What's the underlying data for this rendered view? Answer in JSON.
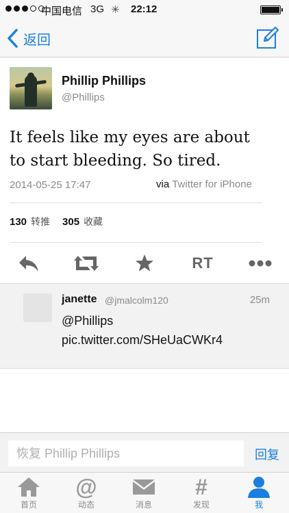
{
  "status_bar": {
    "carrier": "中国电信",
    "network": "3G",
    "time": "22:12"
  },
  "nav": {
    "back_label": "返回"
  },
  "tweet": {
    "user_name": "Phillip Phillips",
    "user_handle": "@Phillips",
    "text": "It feels like my eyes are about to start bleeding. So tired.",
    "timestamp": "2014-05-25 17:47",
    "via_word": "via",
    "via_source": "Twitter for iPhone",
    "retweets_count": "130",
    "retweets_label": "转推",
    "favorites_count": "305",
    "favorites_label": "收藏"
  },
  "actions": {
    "rt_label": "RT"
  },
  "reply": {
    "name": "janette",
    "handle": "@jmalcolm120",
    "time": "25m",
    "text": "@Phillips pic.twitter.com/SHeUaCWKr4"
  },
  "compose": {
    "placeholder": "恢复 Phillip Phillips",
    "send_label": "回复"
  },
  "tabbar": {
    "tabs": [
      {
        "label": "首页",
        "icon": "home-icon"
      },
      {
        "label": "动态",
        "icon": "at-icon"
      },
      {
        "label": "消息",
        "icon": "envelope-icon"
      },
      {
        "label": "发现",
        "icon": "hash-icon"
      },
      {
        "label": "我",
        "icon": "person-icon",
        "active": true
      }
    ]
  },
  "colors": {
    "accent": "#1a7fe0",
    "icon_gray": "#666666",
    "muted_text": "#8a8a8a"
  }
}
